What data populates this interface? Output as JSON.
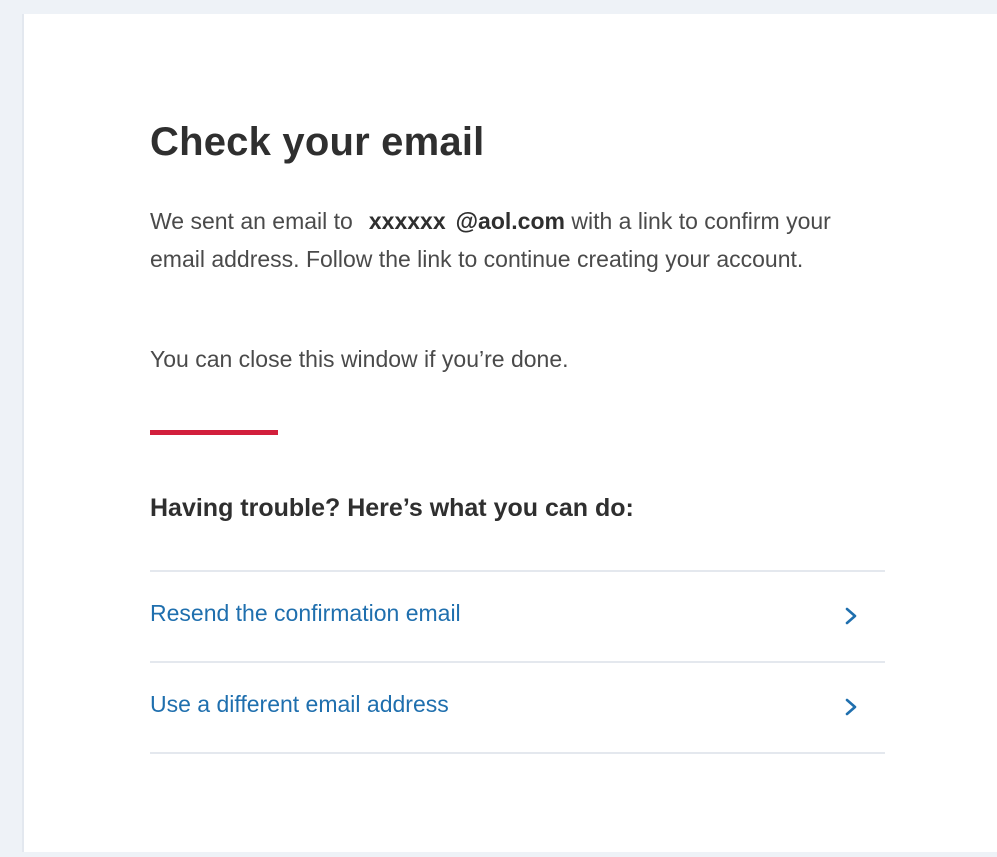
{
  "heading": "Check your email",
  "message": {
    "prefix": "We sent an email to",
    "email_local": "xxxxxx",
    "email_domain": "@aol.com",
    "suffix": "with a link to confirm your email address. Follow the link to continue creating your account."
  },
  "close_note": "You can close this window if you’re done.",
  "help": {
    "heading": "Having trouble? Here’s what you can do:",
    "options": [
      {
        "label": "Resend the confirmation email",
        "icon": "chevron-right-icon"
      },
      {
        "label": "Use a different email address",
        "icon": "chevron-right-icon"
      }
    ]
  },
  "colors": {
    "accent": "#d21f3c",
    "link": "#1f6fae",
    "background": "#eef2f7"
  }
}
